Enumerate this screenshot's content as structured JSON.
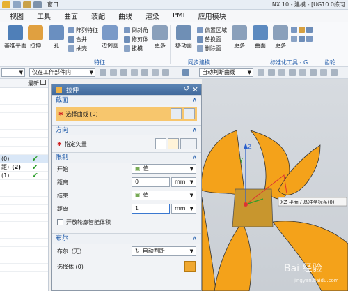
{
  "titlebar": {
    "window_menu": "窗口",
    "doc_title": "NX 10 - 建模 - [UG10.0练习"
  },
  "menu": [
    "视图",
    "工具",
    "曲面",
    "装配",
    "曲线",
    "渲染",
    "PMI",
    "应用模块"
  ],
  "ribbon": {
    "big": [
      {
        "label": "基准平面",
        "color": "#4f7fb8"
      },
      {
        "label": "拉伸",
        "color": "#e0a040"
      },
      {
        "label": "孔",
        "color": "#6a8fc0"
      },
      {
        "label": "边倒圆",
        "color": "#7a9ac8"
      },
      {
        "label": "更多",
        "color": "#8aa0bb"
      },
      {
        "label": "移动面",
        "color": "#6f8fb5"
      },
      {
        "label": "更多",
        "color": "#8aa0bb"
      },
      {
        "label": "曲面",
        "color": "#5c8ac0"
      },
      {
        "label": "更多",
        "color": "#8aa0bb"
      }
    ],
    "small": [
      "阵列特征",
      "合并",
      "抽壳",
      "倒斜角",
      "修剪体",
      "拔模",
      "偏置区域",
      "替换面",
      "删除面"
    ],
    "groups": [
      "特征",
      "同步建模",
      "标准化工具 - G...",
      "齿轮..."
    ]
  },
  "toolbar2": {
    "filter": "",
    "scope": "仅在工作部件内",
    "snap": "自动判断曲线"
  },
  "left_panel": {
    "header_newest": "最新",
    "rows": [
      "",
      "",
      "",
      "",
      "",
      "",
      "",
      "",
      "(0)",
      "",
      "(1)",
      "",
      "",
      "",
      "",
      "",
      "",
      "",
      "",
      "",
      "",
      ""
    ],
    "row_checks": [
      false,
      false,
      false,
      false,
      false,
      false,
      false,
      false,
      true,
      true,
      true,
      false,
      false,
      false,
      false,
      false,
      false,
      false,
      false,
      false,
      false,
      false
    ],
    "partial_label": "距)",
    "partial_count": "(2)"
  },
  "dialog": {
    "title": "拉伸",
    "section_section": "截面",
    "select_curve": "选择曲线 (0)",
    "section_direction": "方向",
    "specify_vector": "指定矢量",
    "section_limits": "限制",
    "start_label": "开始",
    "start_value": "值",
    "distance1_label": "距离",
    "distance1_value": "0",
    "distance1_unit": "mm",
    "end_label": "结束",
    "end_value": "值",
    "distance2_label": "距离",
    "distance2_value": "1",
    "distance2_unit": "mm",
    "open_profile": "开放轮廓智能体积",
    "section_boolean": "布尔",
    "boolean_label": "布尔（无）",
    "boolean_value": "自动判断",
    "select_body": "选择体 (0)"
  },
  "viewport": {
    "tooltip": "XZ 平面 / 基准坐标系(0)",
    "axis_z": "Z",
    "axis_y": "Y",
    "watermark": "Bai 经验",
    "watermark_url": "jingyan.baidu.com",
    "petal_color": "#f4a21a",
    "square_color": "#c8962e"
  }
}
